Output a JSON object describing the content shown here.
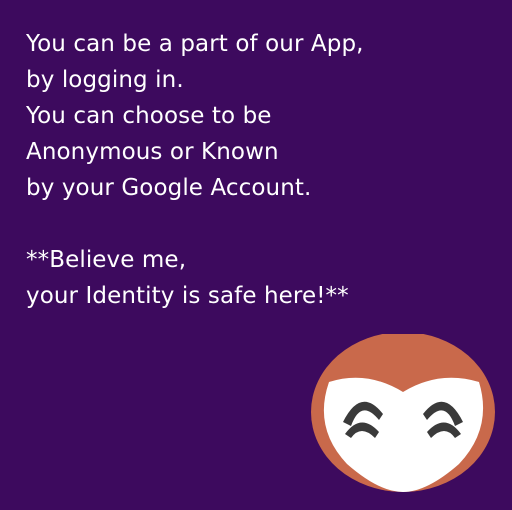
{
  "message": {
    "lines": [
      "You can be a part of our App,",
      "by logging in.",
      "You can choose to be",
      "Anonymous or Known",
      "by your Google Account."
    ],
    "note_lines": [
      "**Believe me,",
      "your Identity is safe here!**"
    ]
  },
  "mascot": {
    "icon": "owl-face-icon"
  },
  "colors": {
    "background": "#3d0a5e",
    "text": "#ffffff",
    "mascot_outer": "#c9694b",
    "mascot_face": "#ffffff",
    "mascot_eyes": "#3a3a3a"
  }
}
